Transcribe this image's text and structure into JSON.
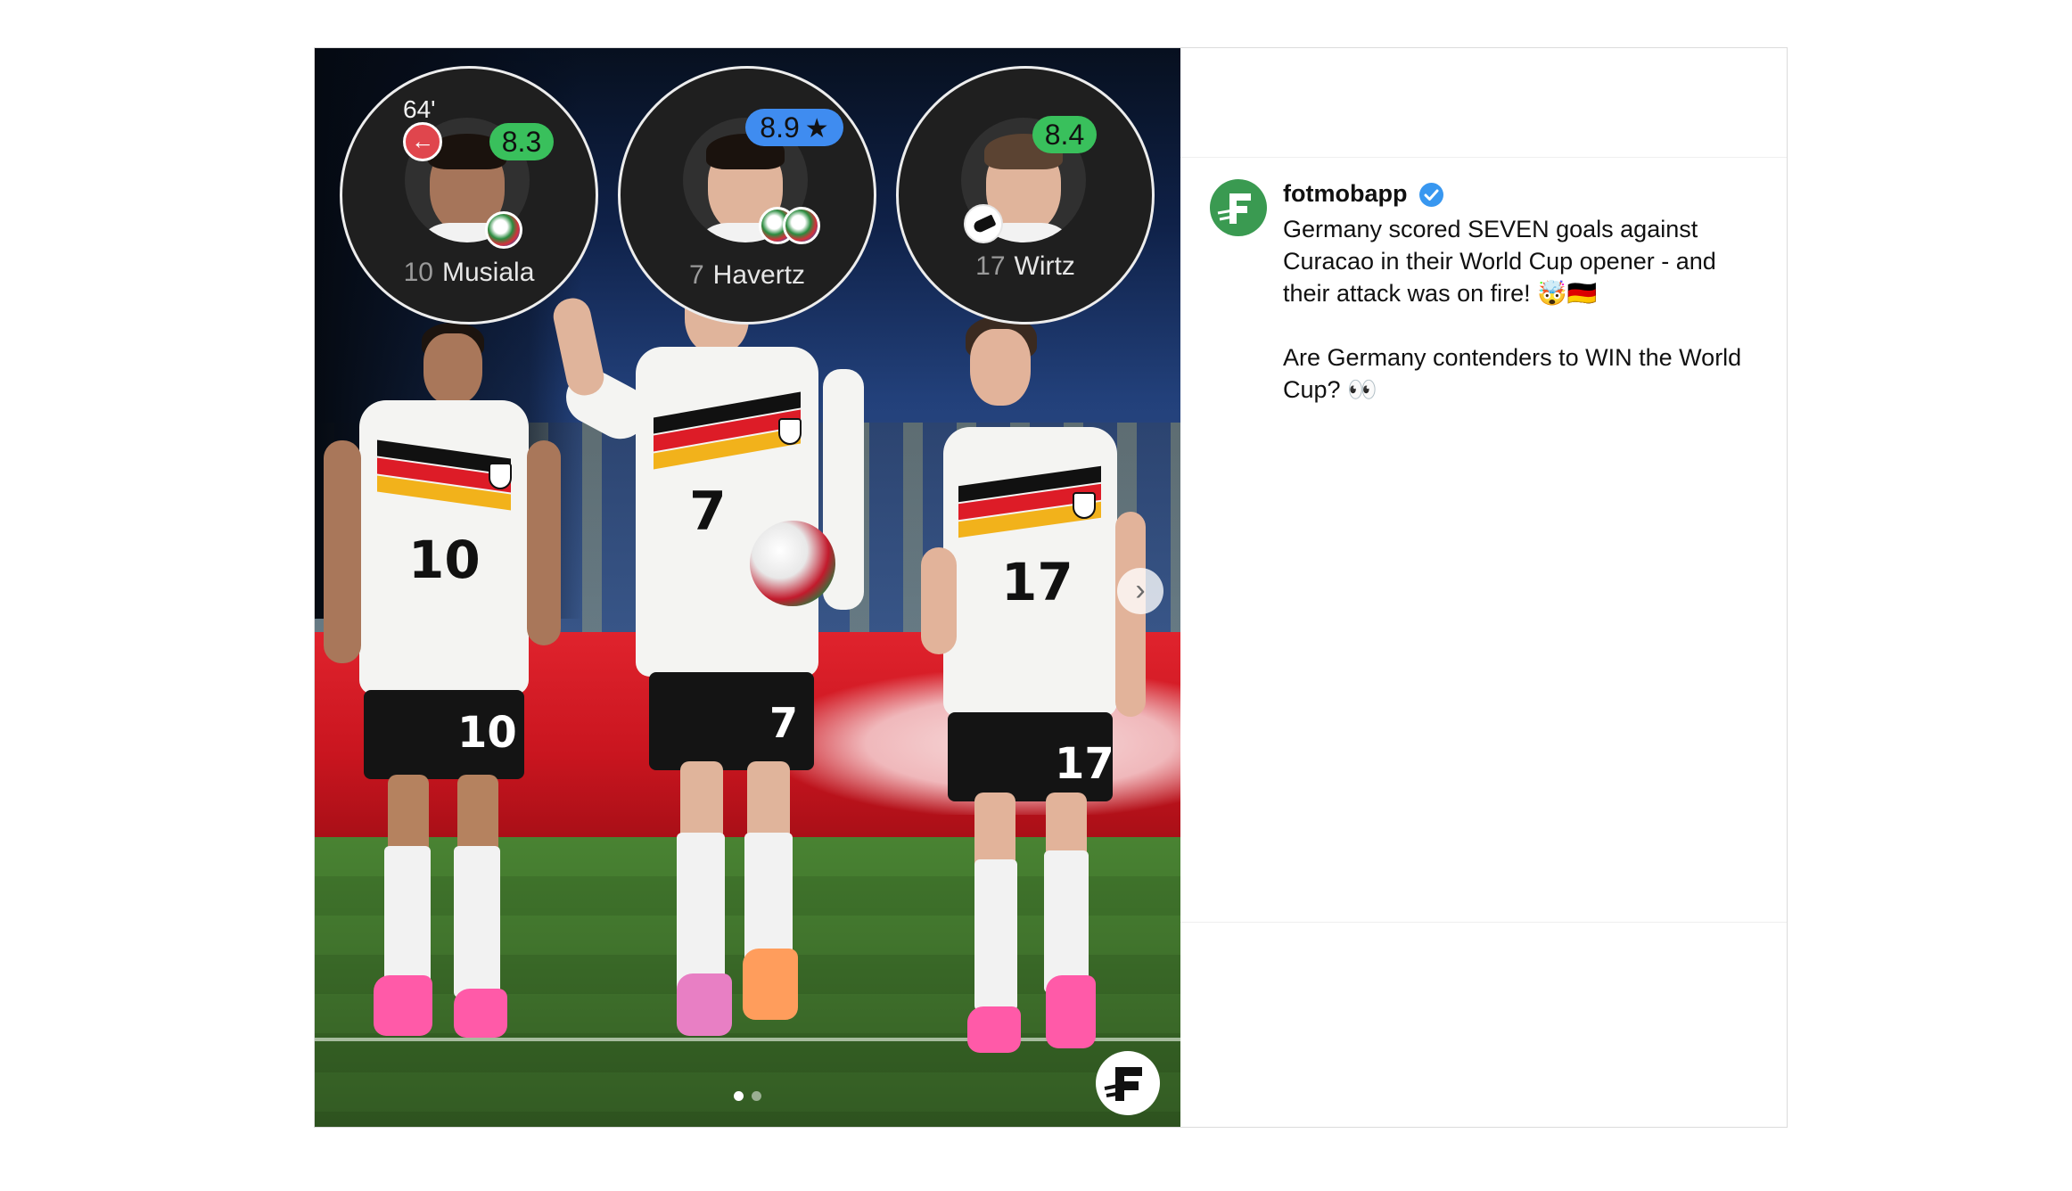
{
  "post": {
    "username": "fotmobapp",
    "verified": true,
    "caption": "Germany scored SEVEN goals against Curacao in their World Cup opener - and their attack was on fire! 🤯🇩🇪\n\nAre Germany contenders to WIN the World Cup? 👀"
  },
  "media": {
    "player_cards": [
      {
        "minute": "64'",
        "substituted_off": true,
        "rating": "8.3",
        "rating_style": "green",
        "player_of_match": false,
        "number": "10",
        "name": "Musiala",
        "badge": "goal-ball-icon"
      },
      {
        "minute": "",
        "substituted_off": false,
        "rating": "8.9",
        "rating_style": "blue",
        "player_of_match": true,
        "number": "7",
        "name": "Havertz",
        "badge": "double-goal-ball-icon"
      },
      {
        "minute": "",
        "substituted_off": false,
        "rating": "8.4",
        "rating_style": "green",
        "player_of_match": false,
        "number": "17",
        "name": "Wirtz",
        "badge": "assist-boot-icon"
      }
    ],
    "shirt_numbers": [
      "10",
      "7",
      "17"
    ],
    "carousel": {
      "total": 2,
      "active": 1
    }
  },
  "colors": {
    "rating_green": "#39c05c",
    "rating_blue": "#3f8cf0",
    "brand_green": "#3a9a51",
    "verified_blue": "#3897f0",
    "germany_black": "#111111",
    "germany_red": "#dd1c27",
    "germany_gold": "#f2b21b"
  }
}
